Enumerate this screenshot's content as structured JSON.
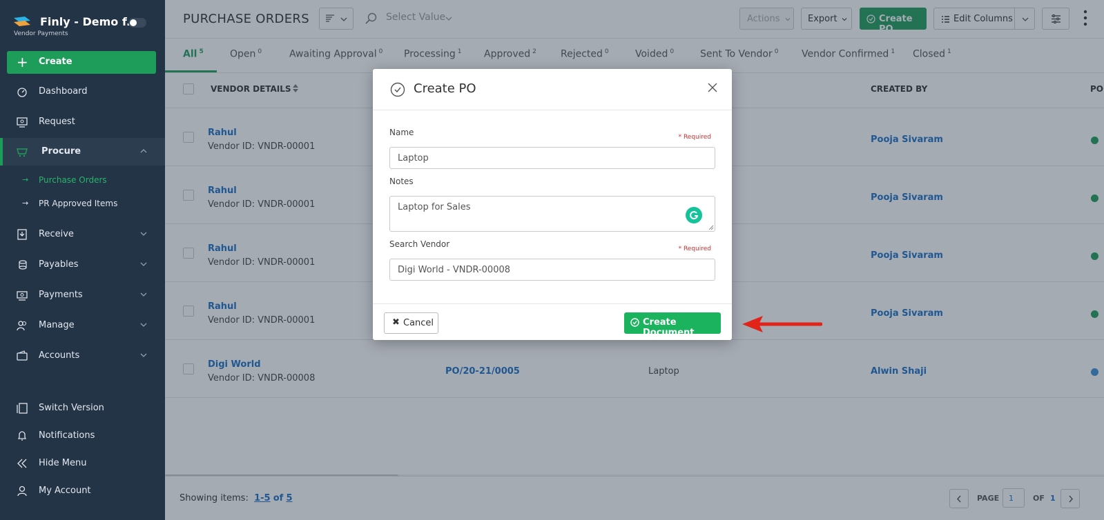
{
  "app": {
    "title": "Finly - Demo f...",
    "subtitle": "Vendor Payments"
  },
  "sidebar": {
    "create_label": "Create",
    "items": [
      {
        "label": "Dashboard",
        "icon": "dashboard-icon"
      },
      {
        "label": "Request",
        "icon": "request-icon"
      },
      {
        "label": "Procure",
        "icon": "cart-icon",
        "active": true
      },
      {
        "label": "Receive",
        "icon": "receive-icon"
      },
      {
        "label": "Payables",
        "icon": "coins-icon"
      },
      {
        "label": "Payments",
        "icon": "payments-icon"
      },
      {
        "label": "Manage",
        "icon": "users-icon"
      },
      {
        "label": "Accounts",
        "icon": "wallet-icon"
      }
    ],
    "sub_items": [
      {
        "label": "Purchase Orders",
        "current": true
      },
      {
        "label": "PR Approved Items"
      }
    ],
    "bottom": [
      {
        "label": "Switch Version"
      },
      {
        "label": "Notifications"
      },
      {
        "label": "Hide Menu"
      },
      {
        "label": "My Account"
      }
    ]
  },
  "header": {
    "title": "PURCHASE ORDERS",
    "search_placeholder": "Select Value",
    "actions_label": "Actions",
    "export_label": "Export",
    "create_po_label": "Create PO",
    "edit_columns_label": "Edit Columns"
  },
  "tabs": [
    {
      "label": "All",
      "count": "5",
      "active": true
    },
    {
      "label": "Open",
      "count": "0"
    },
    {
      "label": "Awaiting Approval",
      "count": "0"
    },
    {
      "label": "Processing",
      "count": "1"
    },
    {
      "label": "Approved",
      "count": "2"
    },
    {
      "label": "Rejected",
      "count": "0"
    },
    {
      "label": "Voided",
      "count": "0"
    },
    {
      "label": "Sent To Vendor",
      "count": "0"
    },
    {
      "label": "Vendor Confirmed",
      "count": "1"
    },
    {
      "label": "Closed",
      "count": "1"
    }
  ],
  "table": {
    "headers": {
      "vendor": "VENDOR DETAILS",
      "created_by": "CREATED BY",
      "po": "PO"
    },
    "rows": [
      {
        "vendor": "Rahul",
        "vendor_id": "Vendor ID: VNDR-00001",
        "po_no": "",
        "item": "",
        "created_by": "Pooja Sivaram",
        "status_color": "#1e9d5a"
      },
      {
        "vendor": "Rahul",
        "vendor_id": "Vendor ID: VNDR-00001",
        "po_no": "",
        "item": "",
        "created_by": "Pooja Sivaram",
        "status_color": "#1e9d5a"
      },
      {
        "vendor": "Rahul",
        "vendor_id": "Vendor ID: VNDR-00001",
        "po_no": "",
        "item": "",
        "created_by": "Pooja Sivaram",
        "status_color": "#1e9d5a"
      },
      {
        "vendor": "Rahul",
        "vendor_id": "Vendor ID: VNDR-00001",
        "po_no": "",
        "item": "",
        "created_by": "Pooja Sivaram",
        "status_color": "#1e9d5a"
      },
      {
        "vendor": "Digi World",
        "vendor_id": "Vendor ID: VNDR-00008",
        "po_no": "PO/20-21/0005",
        "item": "Laptop",
        "created_by": "Alwin Shaji",
        "status_color": "#3a8fd8"
      }
    ]
  },
  "footer": {
    "showing_label": "Showing items:",
    "range": "1-5",
    "of_label": "of",
    "total": "5",
    "page_label": "PAGE",
    "page_value": "1",
    "page_of_label": "OF",
    "page_total": "1"
  },
  "modal": {
    "title": "Create PO",
    "name_label": "Name",
    "name_value": "Laptop",
    "required_label": "* Required",
    "notes_label": "Notes",
    "notes_value": "Laptop for Sales",
    "vendor_label": "Search Vendor",
    "vendor_value": "Digi World - VNDR-00008",
    "cancel_label": "Cancel",
    "create_label": "Create Document"
  }
}
